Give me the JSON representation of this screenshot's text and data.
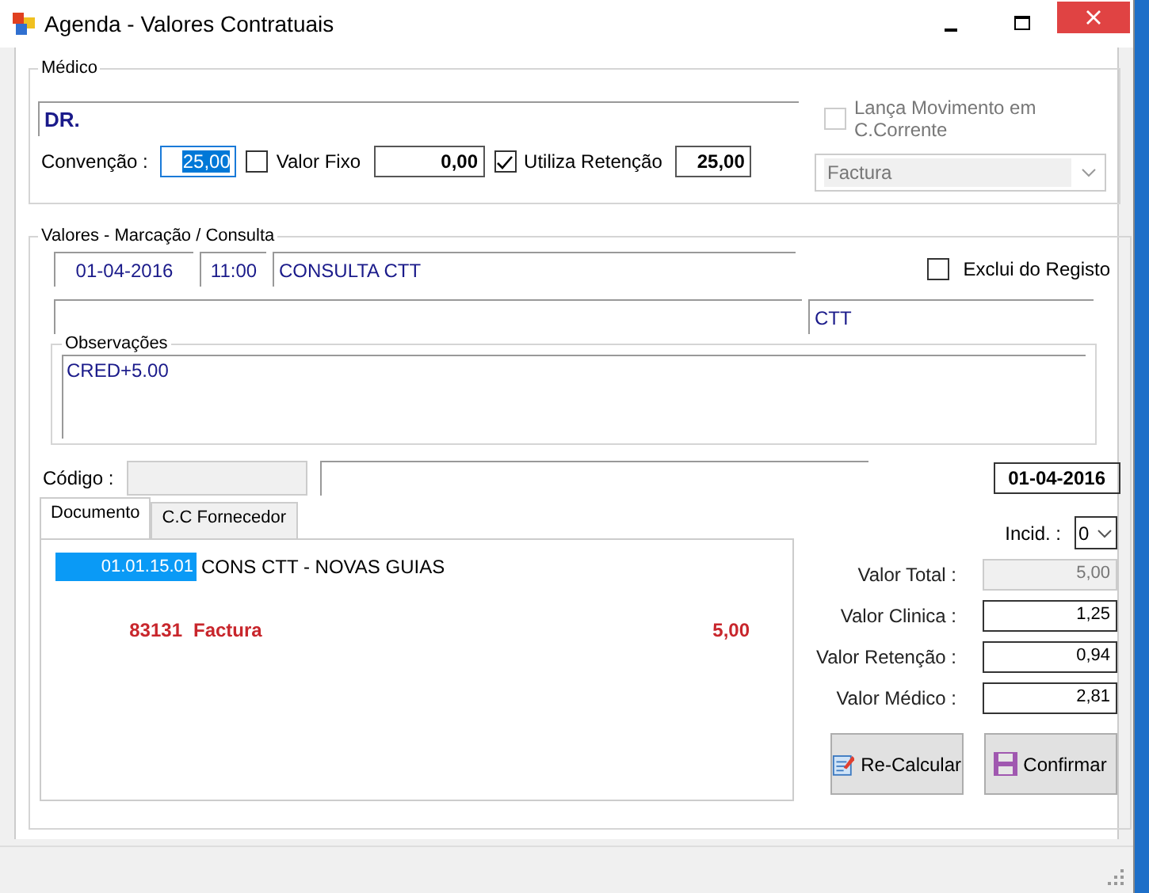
{
  "window": {
    "title": "Agenda - Valores Contratuais"
  },
  "medico": {
    "legend": "Médico",
    "name": "DR.",
    "convencao_label": "Convenção :",
    "convencao": {
      "value": "25,00",
      "focused": true
    },
    "valor_fixo": {
      "label": "Valor Fixo",
      "checked": false
    },
    "valor_fixo_value": "0,00",
    "utiliza_retencao": {
      "label": "Utiliza Retenção",
      "checked": true
    },
    "retencao_value": "25,00",
    "lanca_movimento": {
      "label": "Lança Movimento em C.Corrente",
      "checked": false,
      "disabled": true
    },
    "document_type": {
      "value": "Factura",
      "disabled": true
    }
  },
  "valores": {
    "legend": "Valores - Marcação / Consulta",
    "date": "01-04-2016",
    "time": "11:00",
    "description": "CONSULTA CTT",
    "exclui": {
      "label": "Exclui do Registo",
      "checked": false
    },
    "entity": "CTT",
    "observacoes": {
      "legend": "Observações",
      "text": "CRED+5.00"
    },
    "codigo_label": "Código :",
    "date_2": "01-04-2016"
  },
  "tabs": [
    {
      "label": "Documento",
      "selected": true
    },
    {
      "label": "C.C Fornecedor",
      "selected": false
    }
  ],
  "document_lines": [
    {
      "kind": "service",
      "code": "01.01.15.01",
      "description": "CONS CTT - NOVAS GUIAS",
      "selected": true
    },
    {
      "kind": "invoice",
      "number": "83131",
      "type": "Factura",
      "amount": "5,00"
    }
  ],
  "totals": {
    "incid_label": "Incid. :",
    "incid": "0",
    "rows": [
      {
        "label": "Valor Total :",
        "value": "5,00",
        "disabled": true
      },
      {
        "label": "Valor Clinica :",
        "value": "1,25",
        "disabled": false
      },
      {
        "label": "Valor Retenção :",
        "value": "0,94",
        "disabled": false
      },
      {
        "label": "Valor Médico :",
        "value": "2,81",
        "disabled": false
      }
    ]
  },
  "buttons": [
    {
      "label": "Re-Calcular",
      "kind": "recalc"
    },
    {
      "label": "Confirmar",
      "kind": "save"
    }
  ]
}
